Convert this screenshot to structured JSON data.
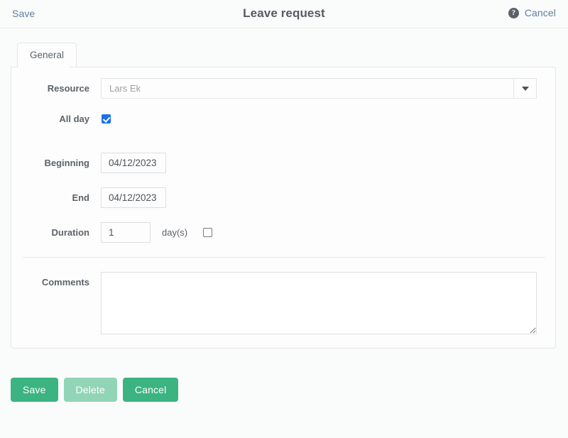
{
  "header": {
    "save_label": "Save",
    "title": "Leave request",
    "help_icon": "help-circle-icon",
    "cancel_label": "Cancel",
    "link_color": "#5e7f9e"
  },
  "tabs": [
    {
      "label": "General",
      "active": true
    }
  ],
  "form": {
    "resource": {
      "label": "Resource",
      "value": "Lars Ek",
      "placeholder": "Lars Ek",
      "dropdown_icon": "chevron-down-icon"
    },
    "all_day": {
      "label": "All day",
      "checked": true,
      "accent_color": "#1a73e8"
    },
    "beginning": {
      "label": "Beginning",
      "value": "04/12/2023"
    },
    "end": {
      "label": "End",
      "value": "04/12/2023"
    },
    "duration": {
      "label": "Duration",
      "value": "1",
      "unit": "day(s)",
      "checked": false
    },
    "comments": {
      "label": "Comments",
      "value": "",
      "placeholder": ""
    }
  },
  "footer": {
    "save_label": "Save",
    "delete_label": "Delete",
    "cancel_label": "Cancel",
    "primary_color": "#3bb481",
    "disabled_color": "#91d5b6"
  }
}
